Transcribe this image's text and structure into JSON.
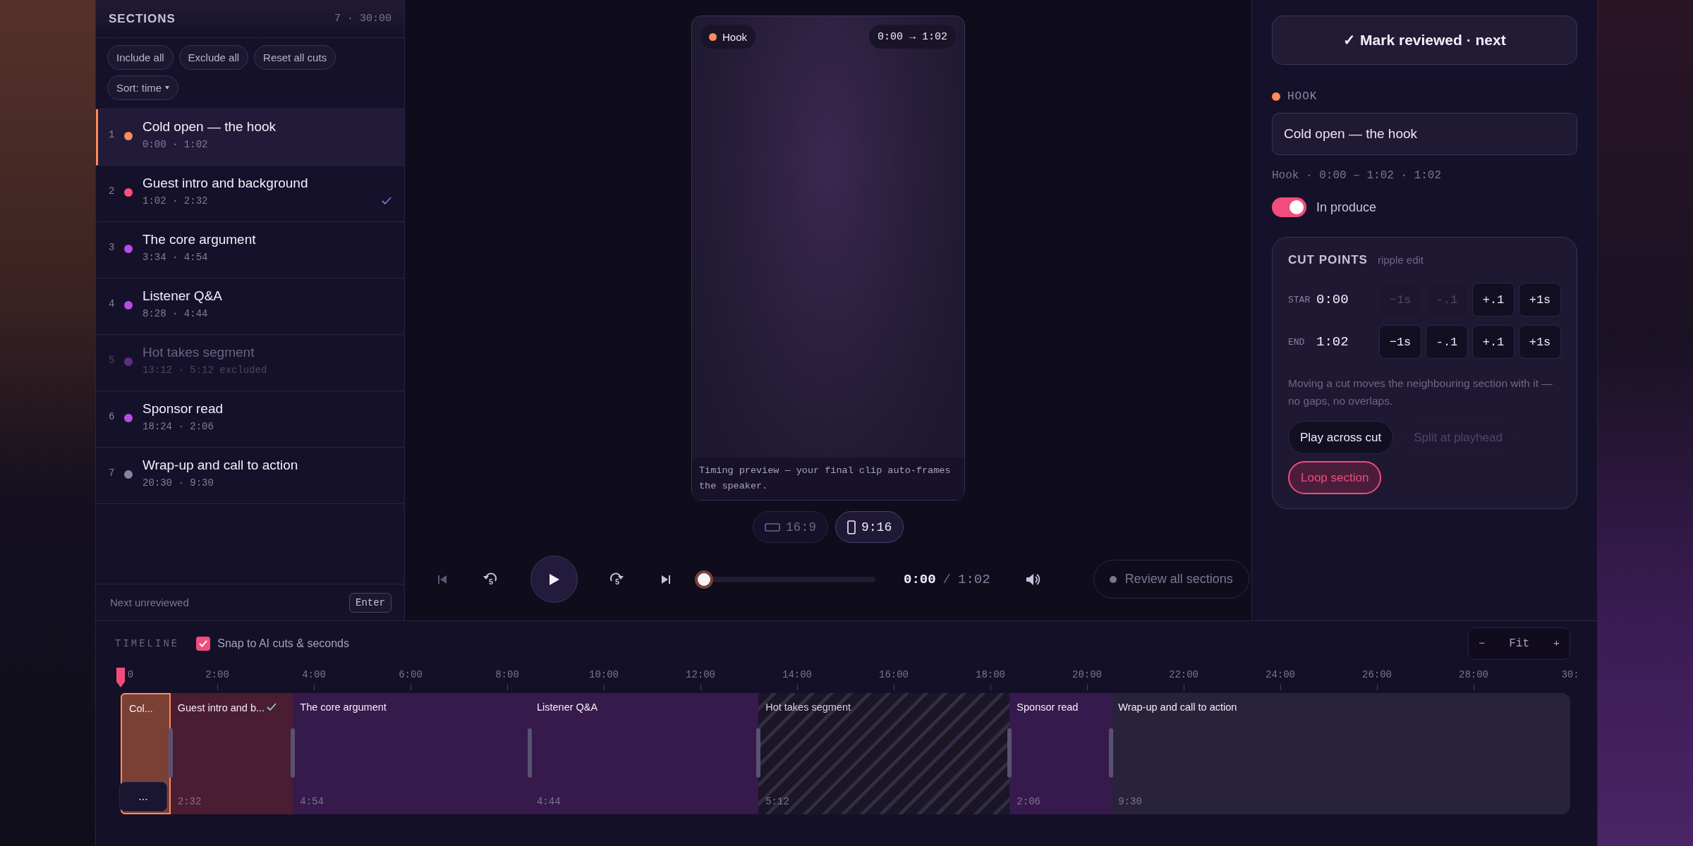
{
  "sidebar": {
    "title": "SECTIONS",
    "summary": "7 · 30:00",
    "actions": [
      "Include all",
      "Exclude all",
      "Reset all cuts"
    ],
    "sort": "Sort: time",
    "separator": "·",
    "sections": [
      {
        "number": "1",
        "title": "Cold open — the hook",
        "start": "0:00",
        "duration": "1:02",
        "color": "#ff8a5b",
        "selected": true,
        "reviewed": false,
        "excluded": false
      },
      {
        "number": "2",
        "title": "Guest intro and background",
        "start": "1:02",
        "duration": "2:32",
        "color": "#ff4f7b",
        "selected": false,
        "reviewed": true,
        "excluded": false
      },
      {
        "number": "3",
        "title": "The core argument",
        "start": "3:34",
        "duration": "4:54",
        "color": "#b44ee6",
        "selected": false,
        "reviewed": false,
        "excluded": false
      },
      {
        "number": "4",
        "title": "Listener Q&A",
        "start": "8:28",
        "duration": "4:44",
        "color": "#b44ee6",
        "selected": false,
        "reviewed": false,
        "excluded": false
      },
      {
        "number": "5",
        "title": "Hot takes segment",
        "start": "13:12",
        "duration": "5:12",
        "note": "excluded",
        "color": "#5b2f80",
        "selected": false,
        "reviewed": false,
        "excluded": true
      },
      {
        "number": "6",
        "title": "Sponsor read",
        "start": "18:24",
        "duration": "2:06",
        "color": "#b44ee6",
        "selected": false,
        "reviewed": false,
        "excluded": false
      },
      {
        "number": "7",
        "title": "Wrap-up and call to action",
        "start": "20:30",
        "duration": "9:30",
        "color": "#8a82a0",
        "selected": false,
        "reviewed": false,
        "excluded": false
      }
    ],
    "footer": {
      "label": "Next unreviewed",
      "key": "Enter"
    }
  },
  "player": {
    "badge": {
      "label": "Hook",
      "color": "#ff8a5b"
    },
    "range": "0:00 → 1:02",
    "caption": "Timing preview — your final clip auto-frames the speaker.",
    "aspects": [
      {
        "label": "16:9",
        "kind": "landscape",
        "selected": false
      },
      {
        "label": "9:16",
        "kind": "portrait",
        "selected": true
      }
    ],
    "rewind": "5",
    "forward": "5",
    "scrubber": {
      "level": 0
    },
    "current": "0:00",
    "separator": "/",
    "total": "1:02",
    "review_button": "Review all sections"
  },
  "inspector": {
    "primary": "✓ Mark reviewed · next",
    "category": {
      "label": "HOOK",
      "color": "#ff8a5b"
    },
    "name": "Cold open — the hook",
    "meta": "Hook · 0:00 – 1:02 · 1:02",
    "toggle": {
      "label": "In produce",
      "on": true
    },
    "cut_points": {
      "title": "CUT POINTS",
      "subtitle": "ripple edit",
      "rows": [
        {
          "label": "STAR",
          "time": "0:00",
          "buttons": [
            {
              "label": "−1s",
              "disabled": true
            },
            {
              "label": "-.1",
              "disabled": true
            },
            {
              "label": "+.1",
              "disabled": false
            },
            {
              "label": "+1s",
              "disabled": false
            }
          ]
        },
        {
          "label": "END",
          "time": "1:02",
          "buttons": [
            {
              "label": "−1s",
              "disabled": false
            },
            {
              "label": "-.1",
              "disabled": false
            },
            {
              "label": "+.1",
              "disabled": false
            },
            {
              "label": "+1s",
              "disabled": false
            }
          ]
        }
      ],
      "note": "Moving a cut moves the neighbouring section with it — no gaps, no overlaps.",
      "actions": [
        {
          "label": "Play across cut",
          "disabled": false,
          "active": false
        },
        {
          "label": "Split at playhead",
          "disabled": true,
          "active": false
        },
        {
          "label": "Loop section",
          "disabled": false,
          "active": true
        }
      ]
    }
  },
  "timeline": {
    "title": "TIMELINE",
    "snap": {
      "label": "Snap to AI cuts & seconds",
      "checked": true
    },
    "zoom": {
      "out": "−",
      "label": "Fit",
      "in": "+"
    },
    "ticks": [
      "0",
      "2:00",
      "4:00",
      "6:00",
      "8:00",
      "10:00",
      "12:00",
      "14:00",
      "16:00",
      "18:00",
      "20:00",
      "22:00",
      "24:00",
      "26:00",
      "28:00",
      "30:"
    ],
    "playhead": {
      "level": 0
    },
    "more": "...",
    "segments": [
      {
        "title": "Col...",
        "color": "#7a3f35",
        "selected": true,
        "reviewed": false,
        "excluded": false
      },
      {
        "title": "Guest intro and b...",
        "duration": "2:32",
        "color": "#4a1d33",
        "selected": false,
        "reviewed": true,
        "excluded": false
      },
      {
        "title": "The core argument",
        "duration": "4:54",
        "color": "#361a4b",
        "selected": false,
        "reviewed": false,
        "excluded": false
      },
      {
        "title": "Listener Q&A",
        "duration": "4:44",
        "color": "#361a4b",
        "selected": false,
        "reviewed": false,
        "excluded": false
      },
      {
        "title": "Hot takes segment",
        "duration": "5:12",
        "color": "#1a1626",
        "selected": false,
        "reviewed": false,
        "excluded": true
      },
      {
        "title": "Sponsor read",
        "duration": "2:06",
        "color": "#371a4d",
        "selected": false,
        "reviewed": false,
        "excluded": false
      },
      {
        "title": "Wrap-up and call to action",
        "duration": "9:30",
        "color": "#28223a",
        "selected": false,
        "reviewed": false,
        "excluded": false
      }
    ]
  }
}
